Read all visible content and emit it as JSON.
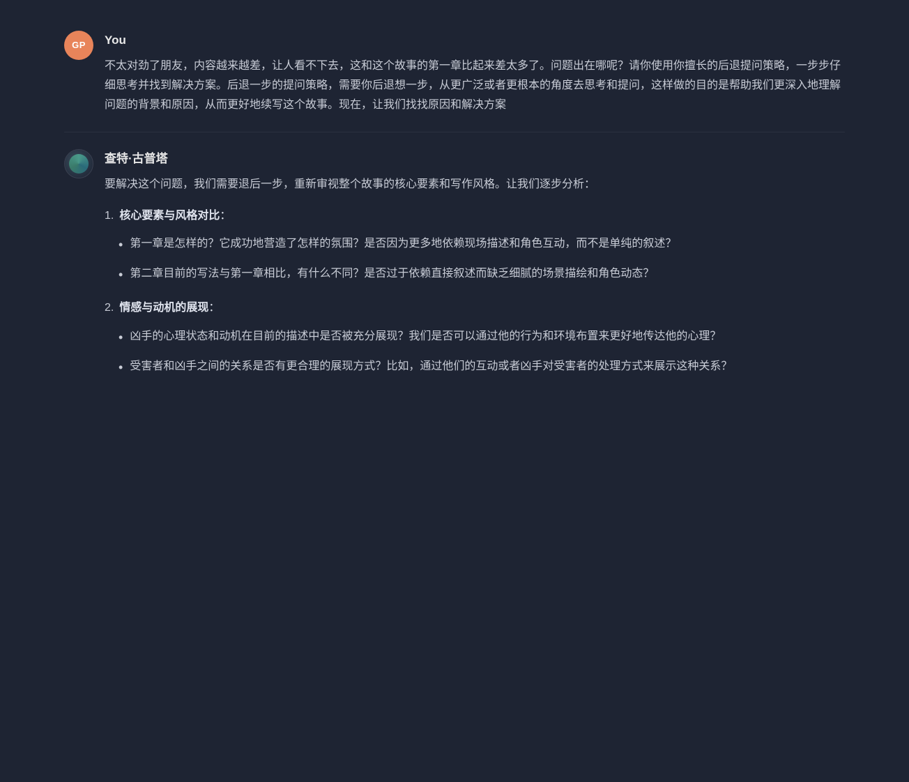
{
  "user_message": {
    "author": "You",
    "avatar_initials": "GP",
    "text": "不太对劲了朋友，内容越来越差，让人看不下去，这和这个故事的第一章比起来差太多了。问题出在哪呢？请你使用你擅长的后退提问策略，一步步仔细思考并找到解决方案。后退一步的提问策略，需要你后退想一步，从更广泛或者更根本的角度去思考和提问，这样做的目的是帮助我们更深入地理解问题的背景和原因，从而更好地续写这个故事。现在，让我们找找原因和解决方案"
  },
  "bot_message": {
    "author": "查特·古普塔",
    "intro": "要解决这个问题，我们需要退后一步，重新审视整个故事的核心要素和写作风格。让我们逐步分析：",
    "sections": [
      {
        "number": "1.",
        "title": "核心要素与风格对比",
        "title_colon": "：",
        "bullets": [
          "第一章是怎样的？它成功地营造了怎样的氛围？是否因为更多地依赖现场描述和角色互动，而不是单纯的叙述？",
          "第二章目前的写法与第一章相比，有什么不同？是否过于依赖直接叙述而缺乏细腻的场景描绘和角色动态？"
        ]
      },
      {
        "number": "2.",
        "title": "情感与动机的展现",
        "title_colon": "：",
        "bullets": [
          "凶手的心理状态和动机在目前的描述中是否被充分展现？我们是否可以通过他的行为和环境布置来更好地传达他的心理？",
          "受害者和凶手之间的关系是否有更合理的展现方式？比如，通过他们的互动或者凶手对受害者的处理方式来展示这种关系？"
        ]
      }
    ]
  },
  "colors": {
    "bg": "#1e2433",
    "text": "#c8ccd6",
    "author": "#e8e8e8",
    "avatar_user_bg": "#e8845a",
    "divider": "#2a3040"
  }
}
